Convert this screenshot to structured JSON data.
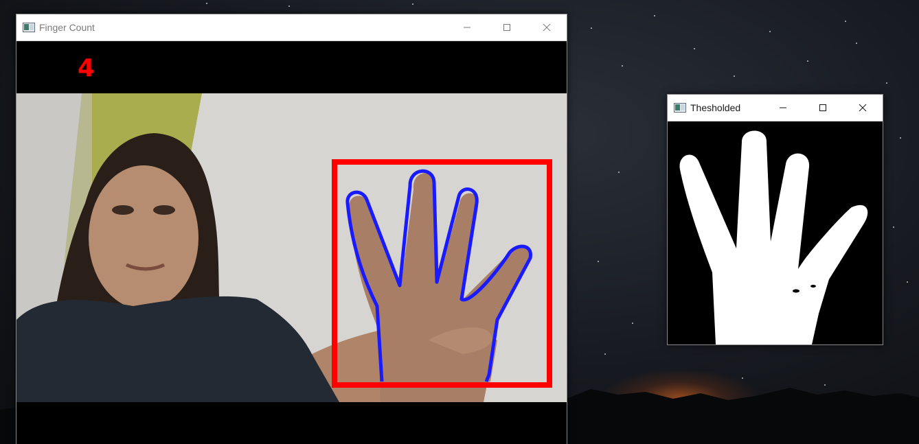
{
  "windows": {
    "finger_count": {
      "title": "Finger Count",
      "count": "4"
    },
    "thresholded": {
      "title": "Thesholded"
    }
  },
  "icons": {
    "app": "opencv-window-icon",
    "minimize": "minimize-icon",
    "maximize": "maximize-icon",
    "close": "close-icon"
  },
  "colors": {
    "roi_box": "#ff0000",
    "contour": "#0000ff",
    "count_text": "#ff0000",
    "mask_fg": "#ffffff",
    "mask_bg": "#000000"
  }
}
